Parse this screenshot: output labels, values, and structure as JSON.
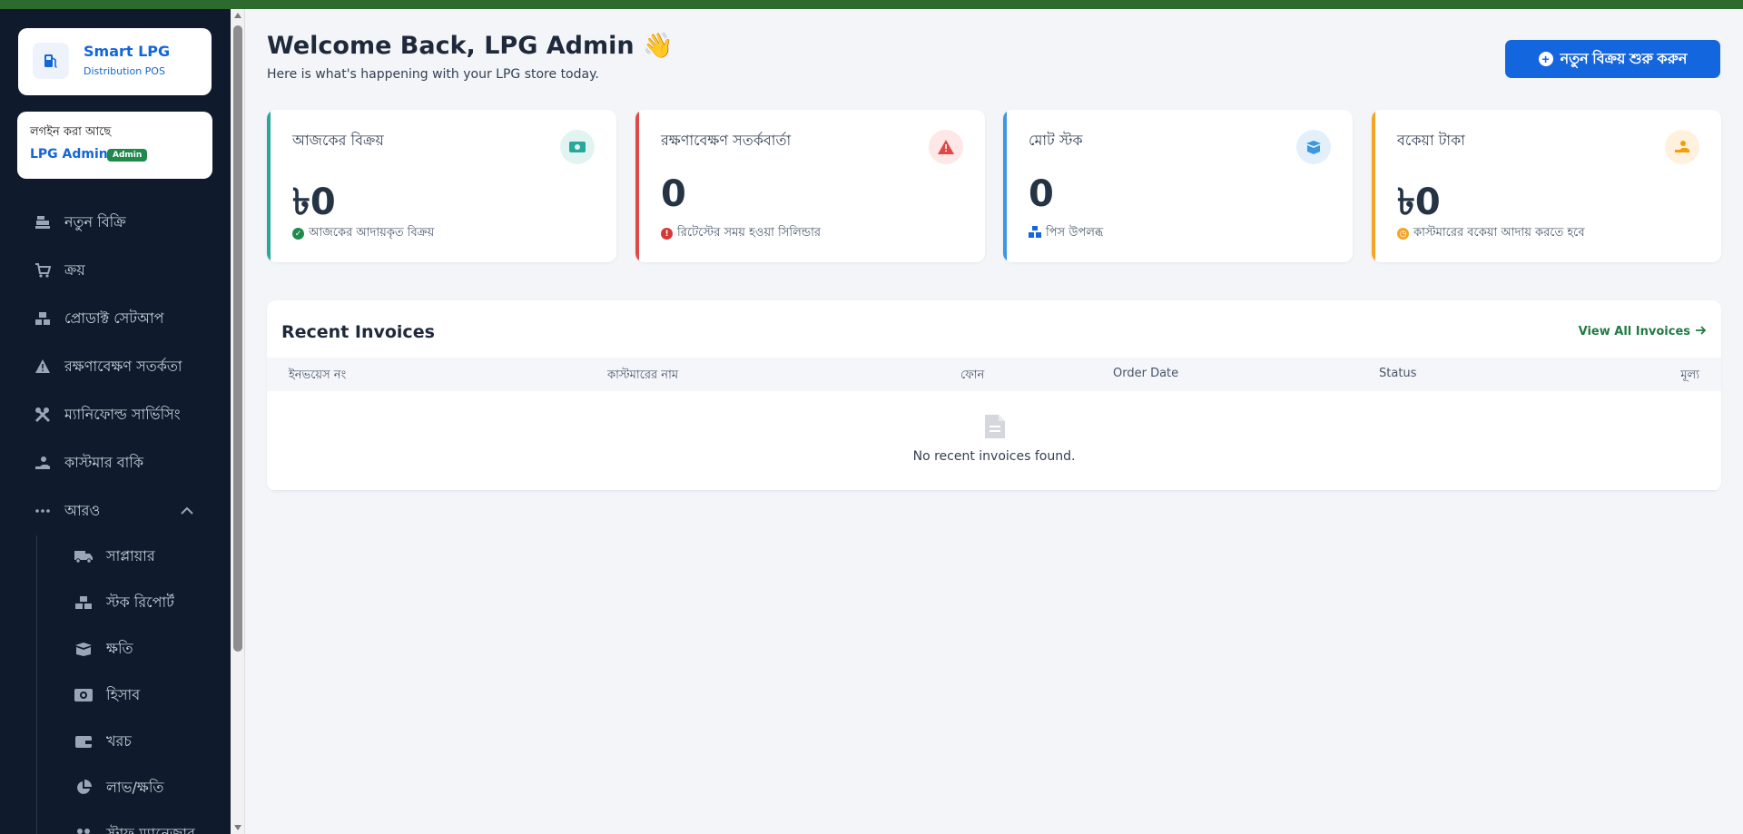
{
  "brand": {
    "name": "Smart LPG",
    "subtitle": "Distribution POS"
  },
  "login": {
    "label": "লগইন করা আছে",
    "user": "LPG Admin",
    "role_badge": "Admin"
  },
  "sidebar": {
    "items": [
      {
        "label": "নতুন বিক্রি",
        "icon": "cash-register-icon"
      },
      {
        "label": "ক্রয়",
        "icon": "cart-icon"
      },
      {
        "label": "প্রোডাক্ট সেটআপ",
        "icon": "boxes-icon"
      },
      {
        "label": "রক্ষণাবেক্ষণ সতর্কতা",
        "icon": "warning-icon"
      },
      {
        "label": "ম্যানিফোল্ড সার্ভিসিং",
        "icon": "tools-icon"
      },
      {
        "label": "কাস্টমার বাকি",
        "icon": "hand-coin-icon"
      },
      {
        "label": "আরও",
        "icon": "more-dots-icon"
      }
    ],
    "sub_items": [
      {
        "label": "সাপ্লায়ার",
        "icon": "truck-icon"
      },
      {
        "label": "স্টক রিপোর্ট",
        "icon": "boxes-icon"
      },
      {
        "label": "ক্ষতি",
        "icon": "box-open-icon"
      },
      {
        "label": "হিসাব",
        "icon": "money-icon"
      },
      {
        "label": "খরচ",
        "icon": "wallet-icon"
      },
      {
        "label": "লাভ/ক্ষতি",
        "icon": "pie-chart-icon"
      },
      {
        "label": "স্টাফ ম্যানেজার",
        "icon": "users-icon"
      }
    ]
  },
  "header": {
    "title": "Welcome Back, LPG Admin 👋",
    "subtitle": "Here is what's happening with your LPG store today.",
    "new_sale_button": "নতুন বিক্রয় শুরু করুন"
  },
  "cards": [
    {
      "title": "আজকের বিক্রয়",
      "value": "৳0",
      "note": "আজকের আদায়কৃত বিক্রয়",
      "accent": "#2aa79b",
      "icon": "money-bill-icon"
    },
    {
      "title": "রক্ষণাবেক্ষণ সতর্কবার্তা",
      "value": "0",
      "note": "রিটেস্টের সময় হওয়া সিলিন্ডার",
      "accent": "#e04848",
      "icon": "warning-icon"
    },
    {
      "title": "মোট স্টক",
      "value": "0",
      "note": "পিস উপলব্ধ",
      "accent": "#3b97e0",
      "icon": "box-icon"
    },
    {
      "title": "বকেয়া টাকা",
      "value": "৳0",
      "note": "কাস্টমারের বকেয়া আদায় করতে হবে",
      "accent": "#f5a524",
      "icon": "hand-coin-icon"
    }
  ],
  "invoices": {
    "title": "Recent Invoices",
    "view_all": "View All Invoices",
    "columns": [
      "ইনভয়েস নং",
      "কাস্টমারের নাম",
      "ফোন",
      "Order Date",
      "Status",
      "মূল্য"
    ],
    "empty_text": "No recent invoices found."
  }
}
